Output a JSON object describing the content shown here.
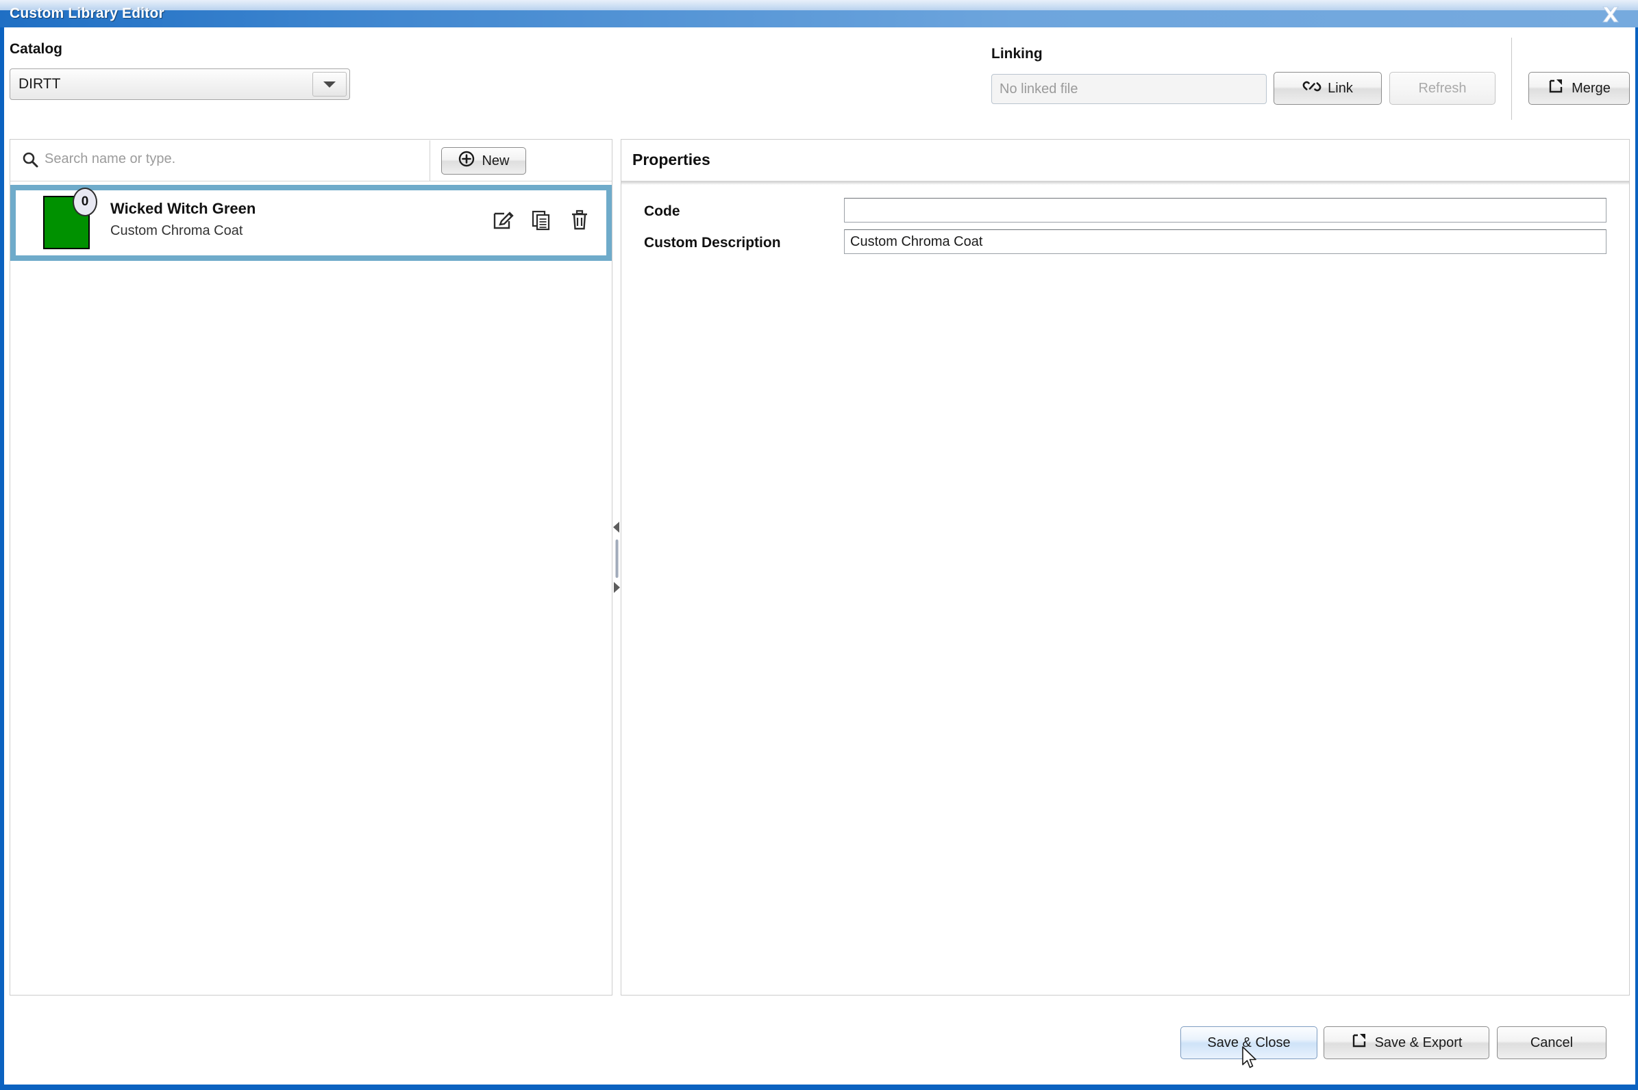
{
  "window": {
    "title": "Custom Library Editor",
    "close_icon": "close-icon",
    "accent_color": "#0b62c0",
    "titlebar_gradient_from": "#1f6fc4",
    "titlebar_gradient_to": "#76aade"
  },
  "catalog": {
    "label": "Catalog",
    "selected": "DIRTT",
    "dropdown_icon": "chevron-down-icon"
  },
  "linking": {
    "label": "Linking",
    "file_placeholder": "No linked file",
    "file_value": "",
    "link_button": "Link",
    "link_icon": "chain-link-icon",
    "refresh_button": "Refresh",
    "refresh_disabled": true,
    "merge_button": "Merge",
    "merge_icon": "merge-export-icon"
  },
  "library": {
    "search_placeholder": "Search name or type.",
    "search_value": "",
    "search_icon": "search-icon",
    "new_button": "New",
    "new_icon": "plus-circle-icon",
    "items": [
      {
        "name": "Wicked Witch Green",
        "type": "Custom Chroma Coat",
        "badge": "0",
        "swatch_color": "#009100",
        "selected": true,
        "actions": [
          "edit-icon",
          "duplicate-icon",
          "delete-icon"
        ]
      }
    ]
  },
  "properties": {
    "title": "Properties",
    "fields": [
      {
        "label": "Code",
        "value": ""
      },
      {
        "label": "Custom Description",
        "value": "Custom Chroma Coat"
      }
    ]
  },
  "footer": {
    "save_close": "Save & Close",
    "save_export": "Save & Export",
    "save_export_icon": "export-icon",
    "cancel": "Cancel"
  },
  "splitter": {
    "collapse_left_icon": "triangle-left-icon",
    "collapse_right_icon": "triangle-right-icon"
  }
}
